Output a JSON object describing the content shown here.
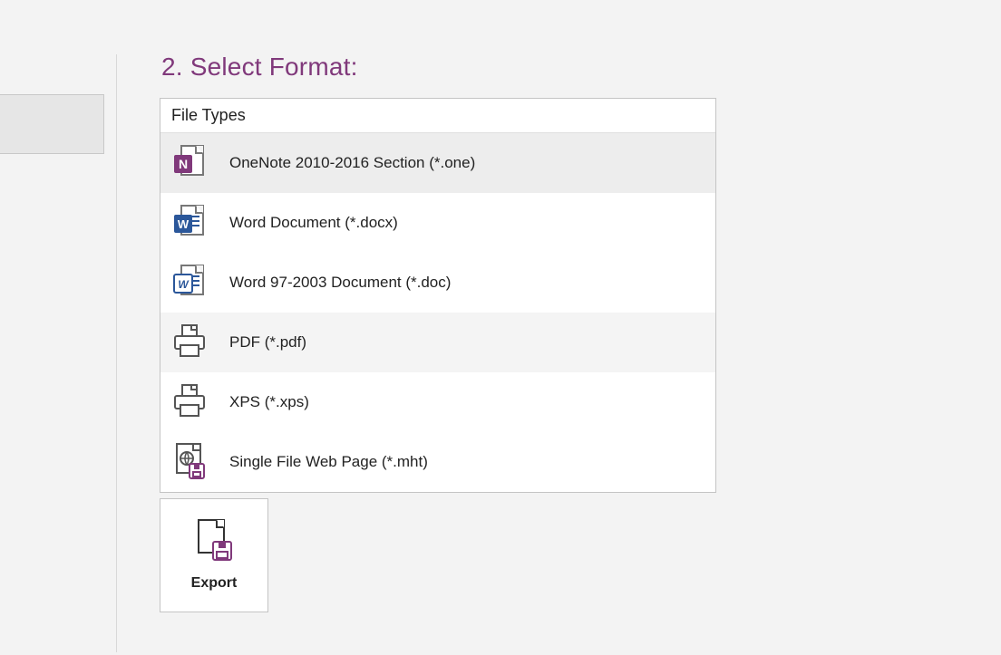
{
  "heading": "2. Select Format:",
  "file_types_header": "File Types",
  "file_types": [
    {
      "label": "OneNote 2010-2016 Section (*.one)",
      "icon": "onenote-file-icon",
      "selected": true
    },
    {
      "label": "Word Document (*.docx)",
      "icon": "word-docx-icon",
      "selected": false
    },
    {
      "label": "Word 97-2003 Document (*.doc)",
      "icon": "word-doc-icon",
      "selected": false
    },
    {
      "label": "PDF (*.pdf)",
      "icon": "printer-icon",
      "selected": false,
      "hover": true
    },
    {
      "label": "XPS (*.xps)",
      "icon": "printer-icon",
      "selected": false
    },
    {
      "label": "Single File Web Page (*.mht)",
      "icon": "web-page-save-icon",
      "selected": false
    }
  ],
  "export_button_label": "Export",
  "colors": {
    "accent_purple": "#80397b",
    "onenote_purple": "#80397b",
    "word_blue": "#2b579a"
  }
}
